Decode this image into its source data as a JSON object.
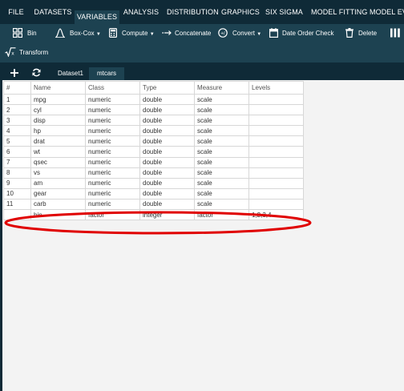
{
  "menu": {
    "file": "FILE",
    "datasets": "DATASETS",
    "variables": "VARIABLES",
    "analysis": "ANALYSIS",
    "distribution": "DISTRIBUTION",
    "graphics": "GRAPHICS",
    "six_sigma": "SIX SIGMA",
    "model_fitting": "MODEL FITTING",
    "model_eval": "MODEL EVALU"
  },
  "toolbar": {
    "bin": "Bin",
    "boxcox": "Box-Cox",
    "compute": "Compute",
    "concatenate": "Concatenate",
    "convert": "Convert",
    "date_order_check": "Date Order Check",
    "delete": "Delete",
    "transform": "Transform"
  },
  "tabs": {
    "dataset1": "Dataset1",
    "mtcars": "mtcars"
  },
  "table": {
    "headers": [
      "#",
      "Name",
      "Class",
      "Type",
      "Measure",
      "Levels"
    ],
    "rows": [
      [
        "1",
        "mpg",
        "numeric",
        "double",
        "scale",
        ""
      ],
      [
        "2",
        "cyl",
        "numeric",
        "double",
        "scale",
        ""
      ],
      [
        "3",
        "disp",
        "numeric",
        "double",
        "scale",
        ""
      ],
      [
        "4",
        "hp",
        "numeric",
        "double",
        "scale",
        ""
      ],
      [
        "5",
        "drat",
        "numeric",
        "double",
        "scale",
        ""
      ],
      [
        "6",
        "wt",
        "numeric",
        "double",
        "scale",
        ""
      ],
      [
        "7",
        "qsec",
        "numeric",
        "double",
        "scale",
        ""
      ],
      [
        "8",
        "vs",
        "numeric",
        "double",
        "scale",
        ""
      ],
      [
        "9",
        "am",
        "numeric",
        "double",
        "scale",
        ""
      ],
      [
        "10",
        "gear",
        "numeric",
        "double",
        "scale",
        ""
      ],
      [
        "11",
        "carb",
        "numeric",
        "double",
        "scale",
        ""
      ],
      [
        "",
        "bin",
        "factor",
        "integer",
        "factor",
        "1,2,3,4"
      ]
    ]
  },
  "colors": {
    "menubar": "#0f2a37",
    "toolbar": "#1d4251",
    "content": "#f3f3f3",
    "annotation": "#e00000"
  },
  "icons": {
    "bin": "grid-icon",
    "boxcox": "curve-icon",
    "compute": "calculator-icon",
    "concatenate": "arrows-join-icon",
    "convert": "convert-icon",
    "date_order_check": "calendar-icon",
    "delete": "trash-icon",
    "transform": "sqrt-icon",
    "add": "plus-icon",
    "refresh": "refresh-icon"
  }
}
